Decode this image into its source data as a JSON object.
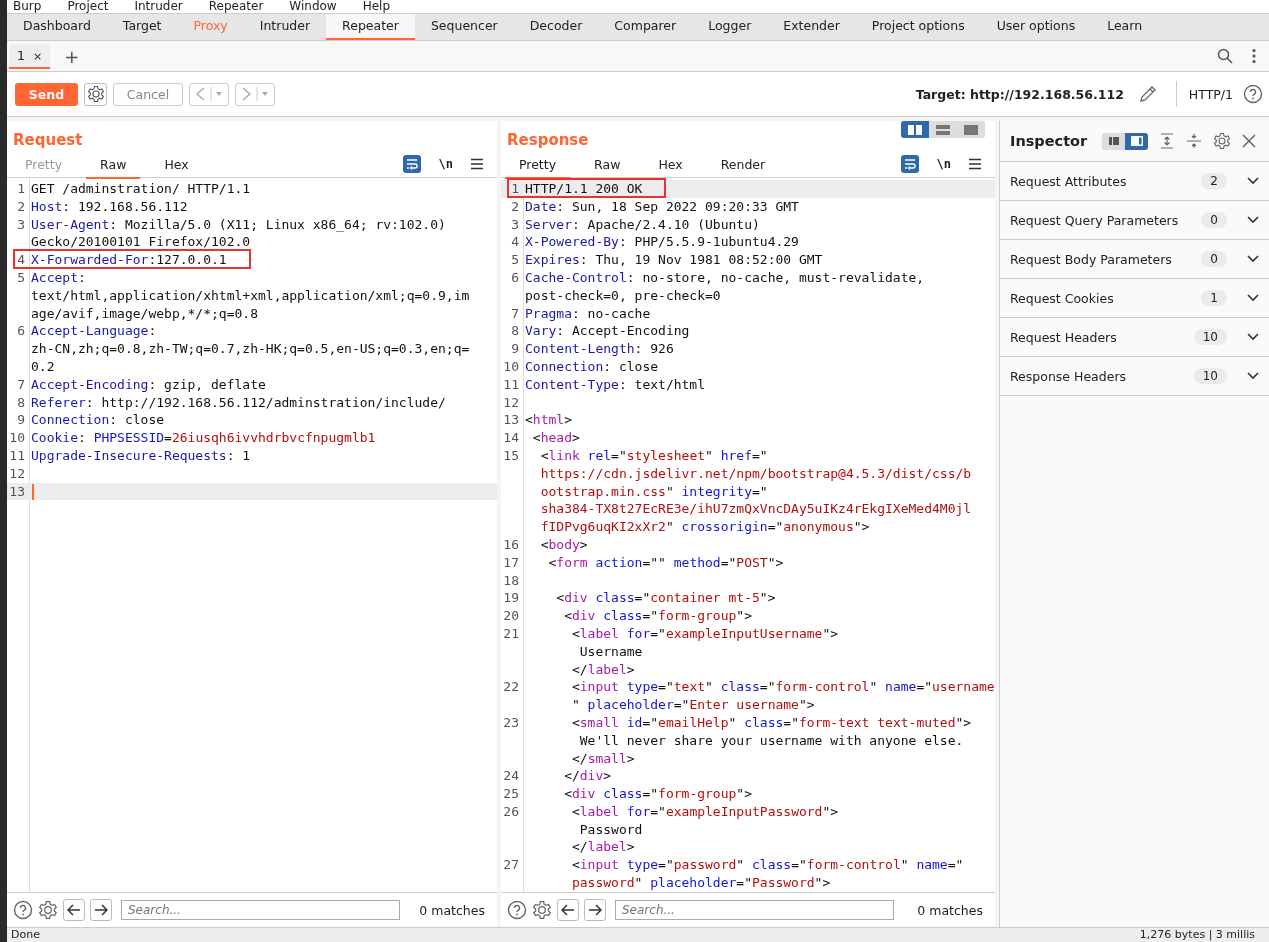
{
  "menu": [
    "Burp",
    "Project",
    "Intruder",
    "Repeater",
    "Window",
    "Help"
  ],
  "tabs": [
    {
      "label": "Dashboard",
      "selected": false,
      "alert": false
    },
    {
      "label": "Target",
      "selected": false,
      "alert": false
    },
    {
      "label": "Proxy",
      "selected": false,
      "alert": true
    },
    {
      "label": "Intruder",
      "selected": false,
      "alert": false
    },
    {
      "label": "Repeater",
      "selected": true,
      "alert": false
    },
    {
      "label": "Sequencer",
      "selected": false,
      "alert": false
    },
    {
      "label": "Decoder",
      "selected": false,
      "alert": false
    },
    {
      "label": "Comparer",
      "selected": false,
      "alert": false
    },
    {
      "label": "Logger",
      "selected": false,
      "alert": false
    },
    {
      "label": "Extender",
      "selected": false,
      "alert": false
    },
    {
      "label": "Project options",
      "selected": false,
      "alert": false
    },
    {
      "label": "User options",
      "selected": false,
      "alert": false
    },
    {
      "label": "Learn",
      "selected": false,
      "alert": false
    }
  ],
  "repeater_tabs": [
    {
      "label": "1",
      "close": "×",
      "selected": true
    }
  ],
  "add_tab": "+",
  "toolbar": {
    "send": "Send",
    "cancel": "Cancel",
    "target": "Target: http://192.168.56.112",
    "protocol": "HTTP/1"
  },
  "request": {
    "title": "Request",
    "tabs": [
      {
        "label": "Pretty",
        "selected": false,
        "disabled": true
      },
      {
        "label": "Raw",
        "selected": true,
        "disabled": false
      },
      {
        "label": "Hex",
        "selected": false,
        "disabled": false
      }
    ],
    "newline_toggle": "\\n",
    "lines": [
      {
        "n": "1",
        "parts": [
          "GET /adminstration/ HTTP/1.1"
        ]
      },
      {
        "n": "2",
        "parts": [
          {
            "kind": "h",
            "t": "Host"
          },
          ": 192.168.56.112"
        ]
      },
      {
        "n": "3",
        "parts": [
          {
            "kind": "h",
            "t": "User-Agent"
          },
          ": Mozilla/5.0 (X11; Linux x86_64; rv:102.0)"
        ]
      },
      {
        "parts": [
          "Gecko/20100101 Firefox/102.0"
        ]
      },
      {
        "n": "4",
        "highlighted": true,
        "parts": [
          {
            "kind": "h",
            "t": "X-Forwarded-For"
          },
          ":127.0.0.1"
        ]
      },
      {
        "n": "5",
        "parts": [
          {
            "kind": "h",
            "t": "Accept"
          },
          ":"
        ]
      },
      {
        "parts": [
          "text/html,application/xhtml+xml,application/xml;q=0.9,im"
        ]
      },
      {
        "parts": [
          "age/avif,image/webp,*/*;q=0.8"
        ]
      },
      {
        "n": "6",
        "parts": [
          {
            "kind": "h",
            "t": "Accept-Language"
          },
          ":"
        ]
      },
      {
        "parts": [
          "zh-CN,zh;q=0.8,zh-TW;q=0.7,zh-HK;q=0.5,en-US;q=0.3,en;q="
        ]
      },
      {
        "parts": [
          "0.2"
        ]
      },
      {
        "n": "7",
        "parts": [
          {
            "kind": "h",
            "t": "Accept-Encoding"
          },
          ": gzip, deflate"
        ]
      },
      {
        "n": "8",
        "parts": [
          {
            "kind": "h",
            "t": "Referer"
          },
          ": http://192.168.56.112/adminstration/include/"
        ]
      },
      {
        "n": "9",
        "parts": [
          {
            "kind": "h",
            "t": "Connection"
          },
          ": close"
        ]
      },
      {
        "n": "10",
        "parts": [
          {
            "kind": "h",
            "t": "Cookie"
          },
          ": ",
          {
            "kind": "attr",
            "t": "PHPSESSID"
          },
          "=",
          {
            "kind": "val",
            "t": "26iusqh6ivvhdrbvcfnpugmlb1"
          }
        ]
      },
      {
        "n": "11",
        "parts": [
          {
            "kind": "h",
            "t": "Upgrade-Insecure-Requests"
          },
          ": 1"
        ]
      },
      {
        "n": "12"
      },
      {
        "n": "13",
        "current": true
      }
    ],
    "search": {
      "placeholder": "Search...",
      "matches": "0 matches"
    }
  },
  "response": {
    "title": "Response",
    "layout_buttons": [
      {
        "selected": true
      },
      {
        "selected": false
      },
      {
        "selected": false
      }
    ],
    "tabs": [
      {
        "label": "Pretty",
        "selected": true,
        "disabled": false
      },
      {
        "label": "Raw",
        "selected": false,
        "disabled": false
      },
      {
        "label": "Hex",
        "selected": false,
        "disabled": false
      },
      {
        "label": "Render",
        "selected": false,
        "disabled": false
      }
    ],
    "newline_toggle": "\\n",
    "lines": [
      {
        "n": "1",
        "highlighted": true,
        "current": true,
        "parts": [
          "HTTP/1.1 200 OK"
        ]
      },
      {
        "n": "2",
        "parts": [
          {
            "kind": "h",
            "t": "Date"
          },
          ": Sun, 18 Sep 2022 09:20:33 GMT"
        ]
      },
      {
        "n": "3",
        "parts": [
          {
            "kind": "h",
            "t": "Server"
          },
          ": Apache/2.4.10 (Ubuntu)"
        ]
      },
      {
        "n": "4",
        "parts": [
          {
            "kind": "h",
            "t": "X-Powered-By"
          },
          ": PHP/5.5.9-1ubuntu4.29"
        ]
      },
      {
        "n": "5",
        "parts": [
          {
            "kind": "h",
            "t": "Expires"
          },
          ": Thu, 19 Nov 1981 08:52:00 GMT"
        ]
      },
      {
        "n": "6",
        "parts": [
          {
            "kind": "h",
            "t": "Cache-Control"
          },
          ": no-store, no-cache, must-revalidate,"
        ]
      },
      {
        "parts": [
          "post-check=0, pre-check=0"
        ]
      },
      {
        "n": "7",
        "parts": [
          {
            "kind": "h",
            "t": "Pragma"
          },
          ": no-cache"
        ]
      },
      {
        "n": "8",
        "parts": [
          {
            "kind": "h",
            "t": "Vary"
          },
          ": Accept-Encoding"
        ]
      },
      {
        "n": "9",
        "parts": [
          {
            "kind": "h",
            "t": "Content-Length"
          },
          ": 926"
        ]
      },
      {
        "n": "10",
        "parts": [
          {
            "kind": "h",
            "t": "Connection"
          },
          ": close"
        ]
      },
      {
        "n": "11",
        "parts": [
          {
            "kind": "h",
            "t": "Content-Type"
          },
          ": text/html"
        ]
      },
      {
        "n": "12"
      },
      {
        "n": "13",
        "parts": [
          "<",
          {
            "kind": "tag",
            "t": "html"
          },
          ">"
        ]
      },
      {
        "n": "14",
        "parts": [
          " <",
          {
            "kind": "tag",
            "t": "head"
          },
          ">"
        ]
      },
      {
        "n": "15",
        "parts": [
          "  <",
          {
            "kind": "tag",
            "t": "link"
          },
          {
            "kind": "attr",
            "t": " rel"
          },
          "=\"",
          {
            "kind": "val",
            "t": "stylesheet"
          },
          "\"",
          {
            "kind": "attr",
            "t": " href"
          },
          "=\""
        ]
      },
      {
        "parts": [
          {
            "kind": "val",
            "t": "  https://cdn.jsdelivr.net/npm/bootstrap@4.5.3/dist/css/b"
          }
        ]
      },
      {
        "parts": [
          {
            "kind": "val",
            "t": "  ootstrap.min.css"
          },
          "\"",
          {
            "kind": "attr",
            "t": " integrity"
          },
          "=\""
        ]
      },
      {
        "parts": [
          {
            "kind": "val",
            "t": "  sha384-TX8t27EcRE3e/ihU7zmQxVncDAy5uIKz4rEkgIXeMed4M0jl"
          }
        ]
      },
      {
        "parts": [
          {
            "kind": "val",
            "t": "  fIDPvg6uqKI2xXr2"
          },
          "\"",
          {
            "kind": "attr",
            "t": " crossorigin"
          },
          "=\"",
          {
            "kind": "val",
            "t": "anonymous"
          },
          "\">"
        ]
      },
      {
        "n": "16",
        "parts": [
          "  <",
          {
            "kind": "tag",
            "t": "body"
          },
          ">"
        ]
      },
      {
        "n": "17",
        "parts": [
          "   <",
          {
            "kind": "tag",
            "t": "form"
          },
          {
            "kind": "attr",
            "t": " action"
          },
          "=\"\"",
          {
            "kind": "attr",
            "t": " method"
          },
          "=\"",
          {
            "kind": "val",
            "t": "POST"
          },
          "\">"
        ]
      },
      {
        "n": "18"
      },
      {
        "n": "19",
        "parts": [
          "    <",
          {
            "kind": "tag",
            "t": "div"
          },
          {
            "kind": "attr",
            "t": " class"
          },
          "=\"",
          {
            "kind": "val",
            "t": "container mt-5"
          },
          "\">"
        ]
      },
      {
        "n": "20",
        "parts": [
          "     <",
          {
            "kind": "tag",
            "t": "div"
          },
          {
            "kind": "attr",
            "t": " class"
          },
          "=\"",
          {
            "kind": "val",
            "t": "form-group"
          },
          "\">"
        ]
      },
      {
        "n": "21",
        "parts": [
          "      <",
          {
            "kind": "tag",
            "t": "label"
          },
          {
            "kind": "attr",
            "t": " for"
          },
          "=\"",
          {
            "kind": "val",
            "t": "exampleInputUsername"
          },
          "\">"
        ]
      },
      {
        "parts": [
          "       Username"
        ]
      },
      {
        "parts": [
          "      </",
          {
            "kind": "tag",
            "t": "label"
          },
          ">"
        ]
      },
      {
        "n": "22",
        "parts": [
          "      <",
          {
            "kind": "tag",
            "t": "input"
          },
          {
            "kind": "attr",
            "t": " type"
          },
          "=\"",
          {
            "kind": "val",
            "t": "text"
          },
          "\"",
          {
            "kind": "attr",
            "t": " class"
          },
          "=\"",
          {
            "kind": "val",
            "t": "form-control"
          },
          "\"",
          {
            "kind": "attr",
            "t": " name"
          },
          "=\"",
          {
            "kind": "val",
            "t": "username"
          }
        ]
      },
      {
        "parts": [
          "      \"",
          {
            "kind": "attr",
            "t": " placeholder"
          },
          "=\"",
          {
            "kind": "val",
            "t": "Enter username"
          },
          "\">"
        ]
      },
      {
        "n": "23",
        "parts": [
          "      <",
          {
            "kind": "tag",
            "t": "small"
          },
          {
            "kind": "attr",
            "t": " id"
          },
          "=\"",
          {
            "kind": "val",
            "t": "emailHelp"
          },
          "\"",
          {
            "kind": "attr",
            "t": " class"
          },
          "=\"",
          {
            "kind": "val",
            "t": "form-text text-muted"
          },
          "\">"
        ]
      },
      {
        "parts": [
          "       We'll never share your username with anyone else."
        ]
      },
      {
        "parts": [
          "      </",
          {
            "kind": "tag",
            "t": "small"
          },
          ">"
        ]
      },
      {
        "n": "24",
        "parts": [
          "     </",
          {
            "kind": "tag",
            "t": "div"
          },
          ">"
        ]
      },
      {
        "n": "25",
        "parts": [
          "     <",
          {
            "kind": "tag",
            "t": "div"
          },
          {
            "kind": "attr",
            "t": " class"
          },
          "=\"",
          {
            "kind": "val",
            "t": "form-group"
          },
          "\">"
        ]
      },
      {
        "n": "26",
        "parts": [
          "      <",
          {
            "kind": "tag",
            "t": "label"
          },
          {
            "kind": "attr",
            "t": " for"
          },
          "=\"",
          {
            "kind": "val",
            "t": "exampleInputPassword"
          },
          "\">"
        ]
      },
      {
        "parts": [
          "       Password"
        ]
      },
      {
        "parts": [
          "      </",
          {
            "kind": "tag",
            "t": "label"
          },
          ">"
        ]
      },
      {
        "n": "27",
        "parts": [
          "      <",
          {
            "kind": "tag",
            "t": "input"
          },
          {
            "kind": "attr",
            "t": " type"
          },
          "=\"",
          {
            "kind": "val",
            "t": "password"
          },
          "\"",
          {
            "kind": "attr",
            "t": " class"
          },
          "=\"",
          {
            "kind": "val",
            "t": "form-control"
          },
          "\"",
          {
            "kind": "attr",
            "t": " name"
          },
          "=\""
        ]
      },
      {
        "parts": [
          {
            "kind": "val",
            "t": "      password"
          },
          "\"",
          {
            "kind": "attr",
            "t": " placeholder"
          },
          "=\"",
          {
            "kind": "val",
            "t": "Password"
          },
          "\">"
        ]
      }
    ],
    "search": {
      "placeholder": "Search...",
      "matches": "0 matches"
    }
  },
  "inspector": {
    "title": "Inspector",
    "view_buttons": [
      {
        "selected": false
      },
      {
        "selected": true
      }
    ],
    "sections": [
      {
        "label": "Request Attributes",
        "count": "2"
      },
      {
        "label": "Request Query Parameters",
        "count": "0"
      },
      {
        "label": "Request Body Parameters",
        "count": "0"
      },
      {
        "label": "Request Cookies",
        "count": "1"
      },
      {
        "label": "Request Headers",
        "count": "10"
      },
      {
        "label": "Response Headers",
        "count": "10"
      }
    ]
  },
  "status_bar": {
    "left": "Done",
    "right": "1,276 bytes | 3 millis"
  }
}
